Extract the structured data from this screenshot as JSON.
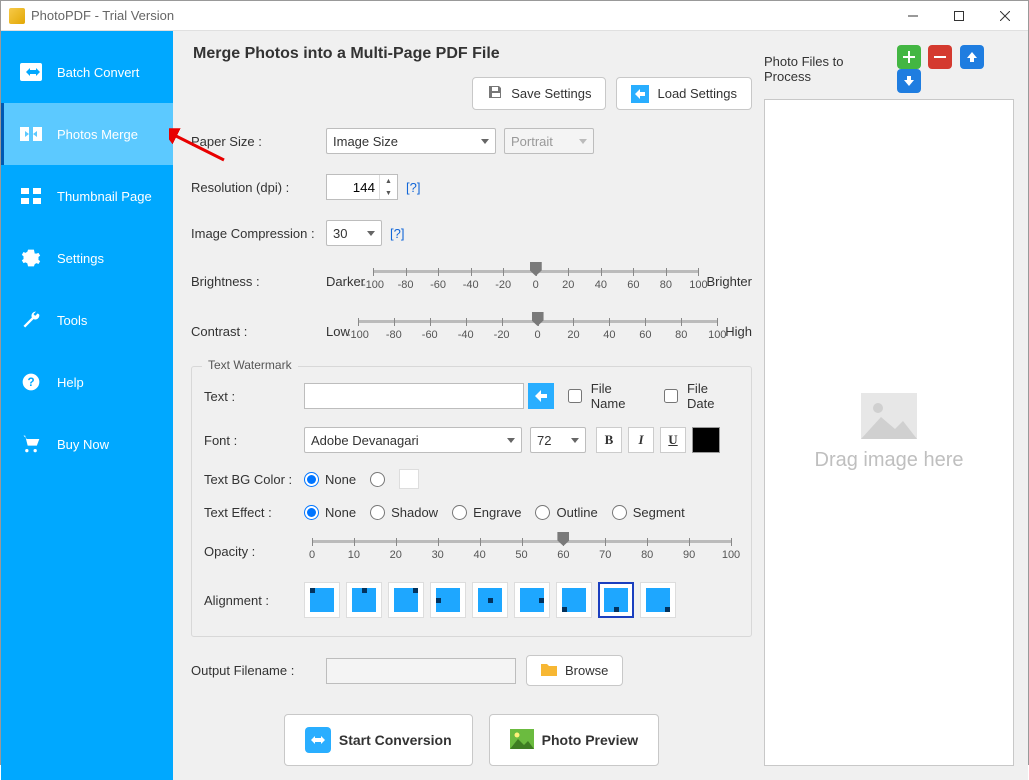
{
  "window": {
    "title": "PhotoPDF - Trial Version"
  },
  "sidebar": {
    "items": [
      {
        "label": "Batch Convert"
      },
      {
        "label": "Photos Merge"
      },
      {
        "label": "Thumbnail Page"
      },
      {
        "label": "Settings"
      },
      {
        "label": "Tools"
      },
      {
        "label": "Help"
      },
      {
        "label": "Buy Now"
      }
    ],
    "active_index": 1
  },
  "page": {
    "title": "Merge Photos into a Multi-Page PDF File",
    "buttons": {
      "save": "Save Settings",
      "load": "Load Settings"
    }
  },
  "paper": {
    "label": "Paper Size :",
    "value": "Image Size",
    "orientation": "Portrait"
  },
  "resolution": {
    "label": "Resolution (dpi) :",
    "value": "144",
    "help": "[?]"
  },
  "compression": {
    "label": "Image Compression :",
    "value": "30",
    "help": "[?]"
  },
  "brightness": {
    "label": "Brightness :",
    "left": "Darker",
    "right": "Brighter",
    "ticks": [
      "-100",
      "-80",
      "-60",
      "-40",
      "-20",
      "0",
      "20",
      "40",
      "60",
      "80",
      "100"
    ],
    "value": 0
  },
  "contrast": {
    "label": "Contrast :",
    "left": "Low",
    "right": "High",
    "ticks": [
      "-100",
      "-80",
      "-60",
      "-40",
      "-20",
      "0",
      "20",
      "40",
      "60",
      "80",
      "100"
    ],
    "value": 0
  },
  "watermark": {
    "legend": "Text Watermark",
    "text_label": "Text :",
    "text_value": "",
    "filename_chk": "File Name",
    "filedate_chk": "File Date",
    "font_label": "Font :",
    "font_value": "Adobe Devanagari",
    "font_size": "72",
    "bg_label": "Text BG Color :",
    "bg_none": "None",
    "effect_label": "Text Effect :",
    "effects": [
      "None",
      "Shadow",
      "Engrave",
      "Outline",
      "Segment"
    ],
    "effect_selected": "None",
    "opacity_label": "Opacity :",
    "opacity_ticks": [
      "0",
      "10",
      "20",
      "30",
      "40",
      "50",
      "60",
      "70",
      "80",
      "90",
      "100"
    ],
    "opacity_value": 60,
    "align_label": "Alignment :",
    "align_selected": 7
  },
  "output": {
    "label": "Output Filename :",
    "value": "",
    "browse": "Browse"
  },
  "actions": {
    "start": "Start Conversion",
    "preview": "Photo Preview"
  },
  "right": {
    "label": "Photo Files to Process",
    "dropzone": "Drag image here"
  }
}
